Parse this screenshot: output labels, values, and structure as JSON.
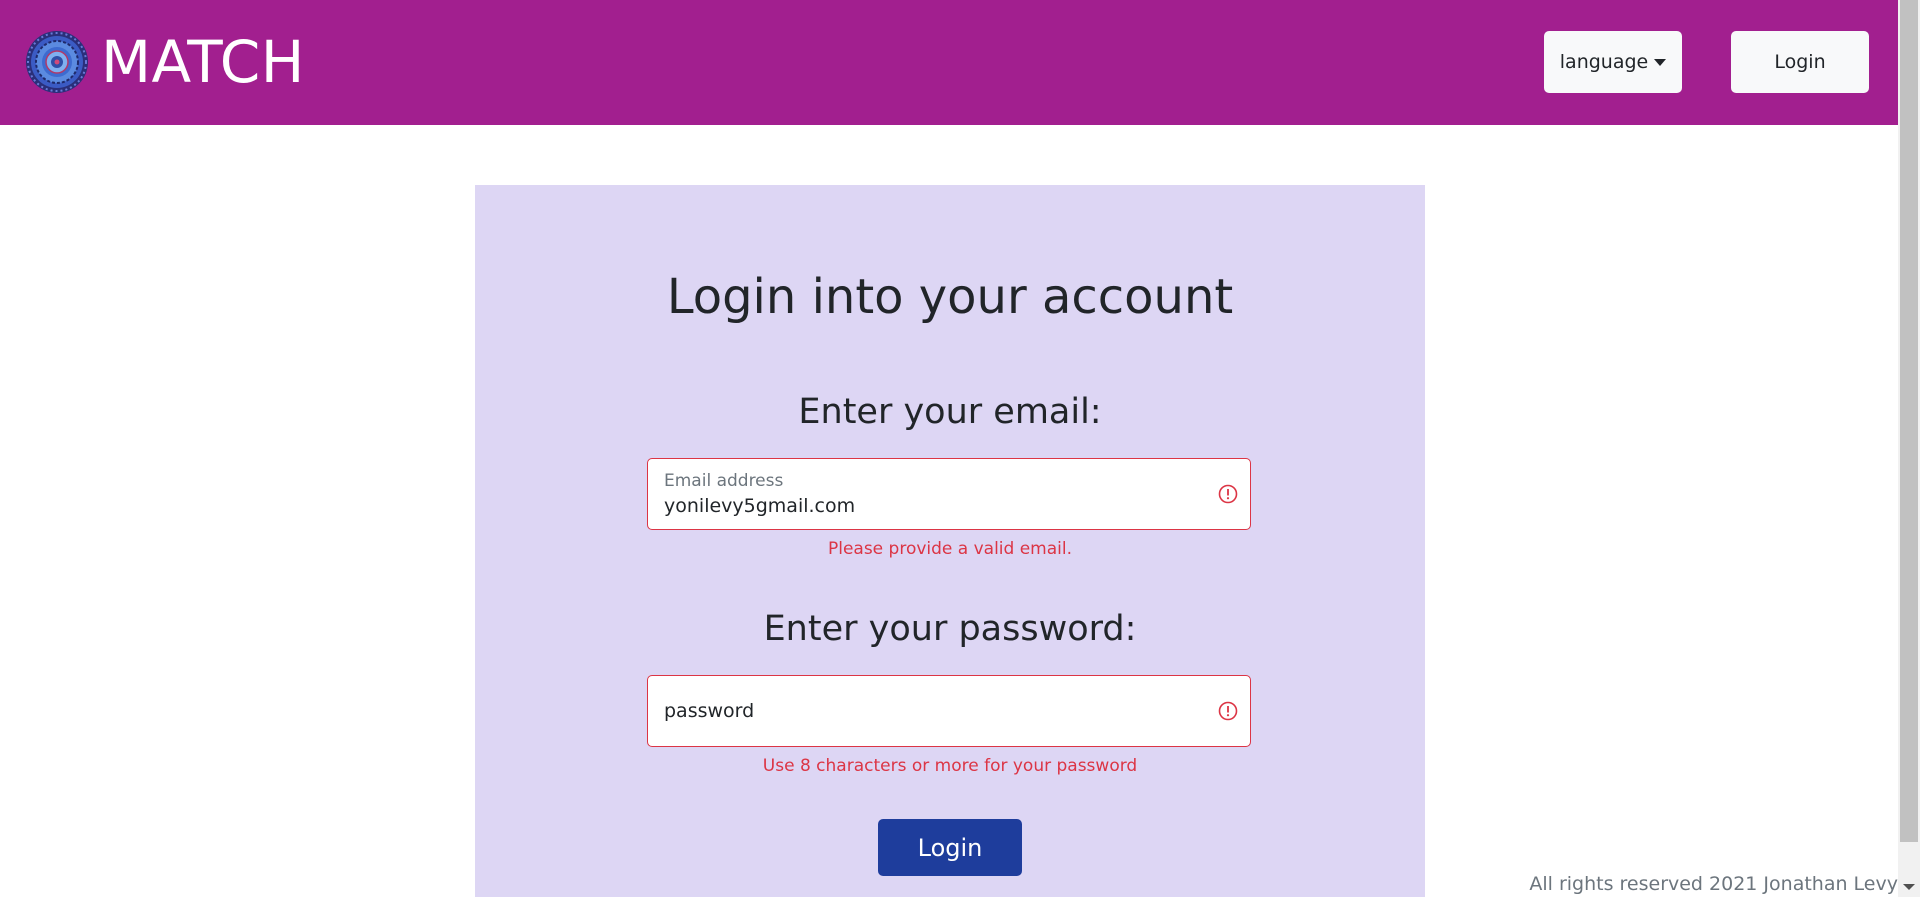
{
  "header": {
    "brand": "MATCH",
    "language_label": "language",
    "login_label": "Login",
    "background_color": "#a21f8f",
    "logo_icon": "mandala-logo-icon"
  },
  "login_form": {
    "title": "Login into your account",
    "email_section_label": "Enter your email:",
    "email_floating_label": "Email address",
    "email_value": "yonilevy5gmail.com",
    "email_error": "Please provide a valid email.",
    "password_section_label": "Enter your password:",
    "password_value": "password",
    "password_error": "Use 8 characters or more for your password",
    "submit_label": "Login",
    "card_color": "#ddd6f4",
    "error_color": "#dc3545",
    "submit_color": "#1e3d9c"
  },
  "footer": {
    "copyright": "All rights reserved 2021 Jonathan Levy"
  }
}
